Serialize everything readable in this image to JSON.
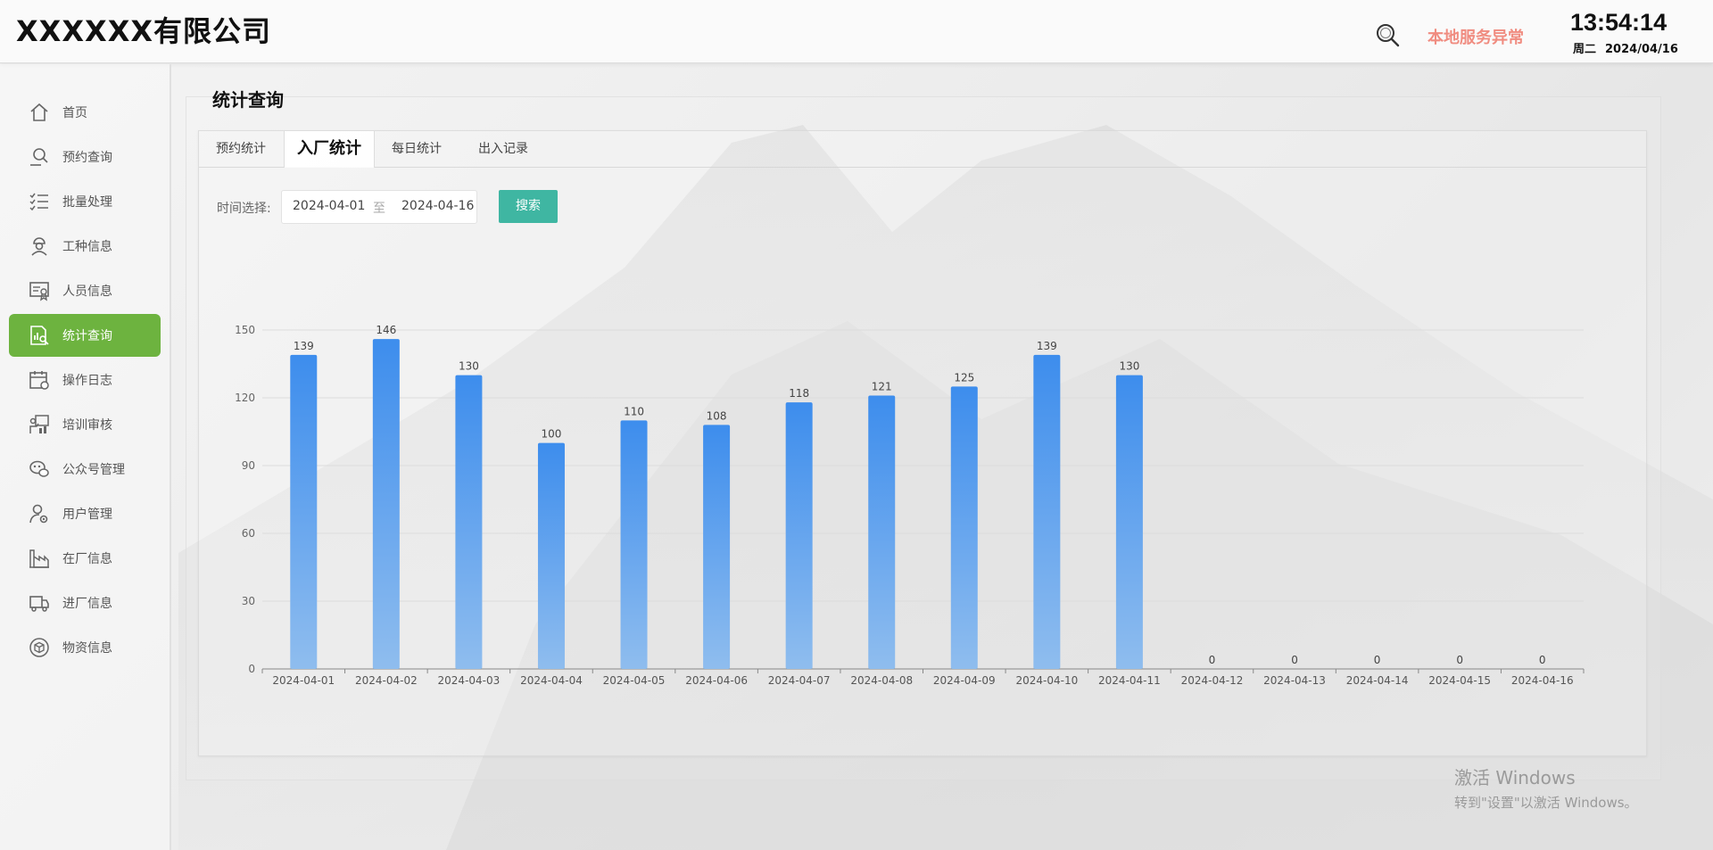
{
  "header": {
    "company": "XXXXXX有限公司",
    "service_status": "本地服务异常",
    "time": "13:54:14",
    "weekday": "周二",
    "date": "2024/04/16"
  },
  "sidebar": {
    "items": [
      {
        "label": "首页",
        "icon": "home-icon"
      },
      {
        "label": "预约查询",
        "icon": "person-search-icon"
      },
      {
        "label": "批量处理",
        "icon": "checklist-icon"
      },
      {
        "label": "工种信息",
        "icon": "worker-icon"
      },
      {
        "label": "人员信息",
        "icon": "id-card-icon"
      },
      {
        "label": "统计查询",
        "icon": "stats-icon",
        "active": true
      },
      {
        "label": "操作日志",
        "icon": "calendar-icon"
      },
      {
        "label": "培训审核",
        "icon": "training-icon"
      },
      {
        "label": "公众号管理",
        "icon": "chat-icon"
      },
      {
        "label": "用户管理",
        "icon": "user-gear-icon"
      },
      {
        "label": "在厂信息",
        "icon": "factory-icon"
      },
      {
        "label": "进厂信息",
        "icon": "truck-icon"
      },
      {
        "label": "物资信息",
        "icon": "box-icon"
      }
    ]
  },
  "main": {
    "title": "统计查询",
    "tabs": [
      {
        "label": "预约统计"
      },
      {
        "label": "入厂统计",
        "active": true
      },
      {
        "label": "每日统计"
      },
      {
        "label": "出入记录"
      }
    ],
    "filter": {
      "label": "时间选择:",
      "start": "2024-04-01",
      "separator": "至",
      "end": "2024-04-16",
      "search_button": "搜索"
    }
  },
  "chart_data": {
    "type": "bar",
    "categories": [
      "2024-04-01",
      "2024-04-02",
      "2024-04-03",
      "2024-04-04",
      "2024-04-05",
      "2024-04-06",
      "2024-04-07",
      "2024-04-08",
      "2024-04-09",
      "2024-04-10",
      "2024-04-11",
      "2024-04-12",
      "2024-04-13",
      "2024-04-14",
      "2024-04-15",
      "2024-04-16"
    ],
    "values": [
      139,
      146,
      130,
      100,
      110,
      108,
      118,
      121,
      125,
      139,
      130,
      0,
      0,
      0,
      0,
      0
    ],
    "ylim": [
      0,
      150
    ],
    "yticks": [
      0,
      30,
      60,
      90,
      120,
      150
    ],
    "grid": true,
    "bar_color_top": "#3d8ded",
    "bar_color_bottom": "#8fbdee"
  },
  "watermark": {
    "line1": "激活 Windows",
    "line2": "转到\"设置\"以激活 Windows。"
  }
}
